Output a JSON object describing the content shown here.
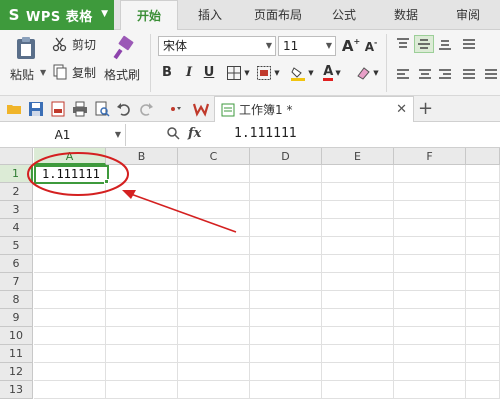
{
  "app": {
    "name": "WPS 表格"
  },
  "tabs": [
    {
      "label": "开始",
      "active": true
    },
    {
      "label": "插入",
      "active": false
    },
    {
      "label": "页面布局",
      "active": false
    },
    {
      "label": "公式",
      "active": false
    },
    {
      "label": "数据",
      "active": false
    },
    {
      "label": "审阅",
      "active": false
    }
  ],
  "ribbon": {
    "paste_label": "粘贴",
    "cut_label": "剪切",
    "copy_label": "复制",
    "format_painter_label": "格式刷",
    "font_name": "宋体",
    "font_size": "11",
    "bold": "B",
    "italic": "I",
    "underline": "U",
    "grow_font": "A",
    "shrink_font": "A",
    "font_color_glyph": "A"
  },
  "quick_bar": {
    "document_tab": "工作簿1 *"
  },
  "formula_bar": {
    "name_box": "A1",
    "fx_label": "fx",
    "value": "1.111111"
  },
  "sheet": {
    "columns": [
      "A",
      "B",
      "C",
      "D",
      "E",
      "F"
    ],
    "rows": [
      "1",
      "2",
      "3",
      "4",
      "5",
      "6",
      "7",
      "8",
      "9",
      "10",
      "11",
      "12",
      "13"
    ],
    "active_cell": "A1",
    "active_cell_value": "1.111111"
  },
  "colors": {
    "accent": "#3e9a3c",
    "annotation": "#d42020"
  }
}
